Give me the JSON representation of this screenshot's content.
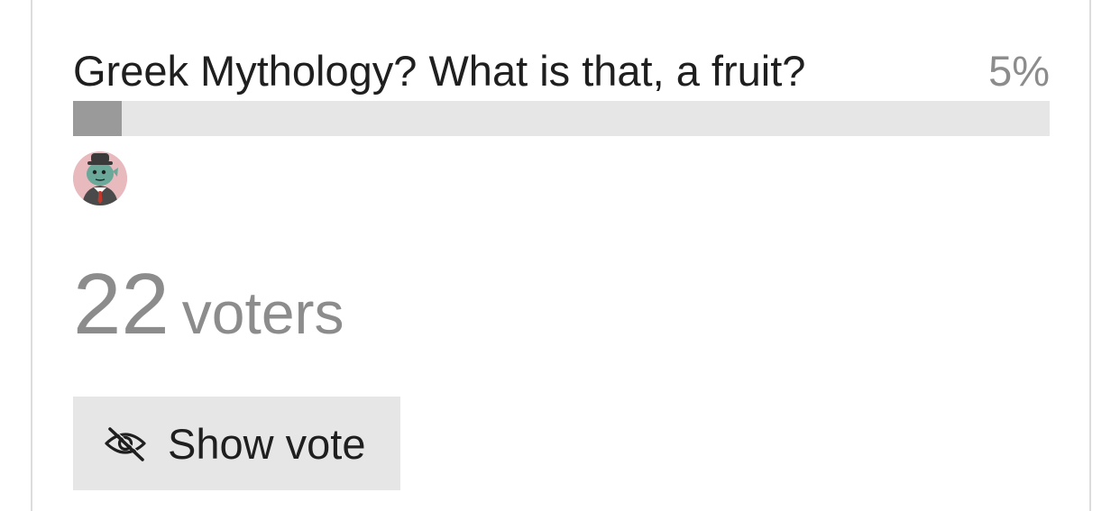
{
  "poll": {
    "option": {
      "label": "Greek Mythology? What is that, a fruit?",
      "percent_text": "5%",
      "percent_value": 0.05
    },
    "voter_count": "22",
    "voter_label": "voters",
    "show_vote_label": "Show vote"
  },
  "icons": {
    "show_vote": "eye-slash-icon",
    "avatar": "user-avatar"
  },
  "colors": {
    "track": "#e6e6e6",
    "fill": "#9a9a9a",
    "muted_text": "#8c8c8c",
    "text": "#1f1f1f",
    "avatar_bg": "#e8b9bd"
  }
}
